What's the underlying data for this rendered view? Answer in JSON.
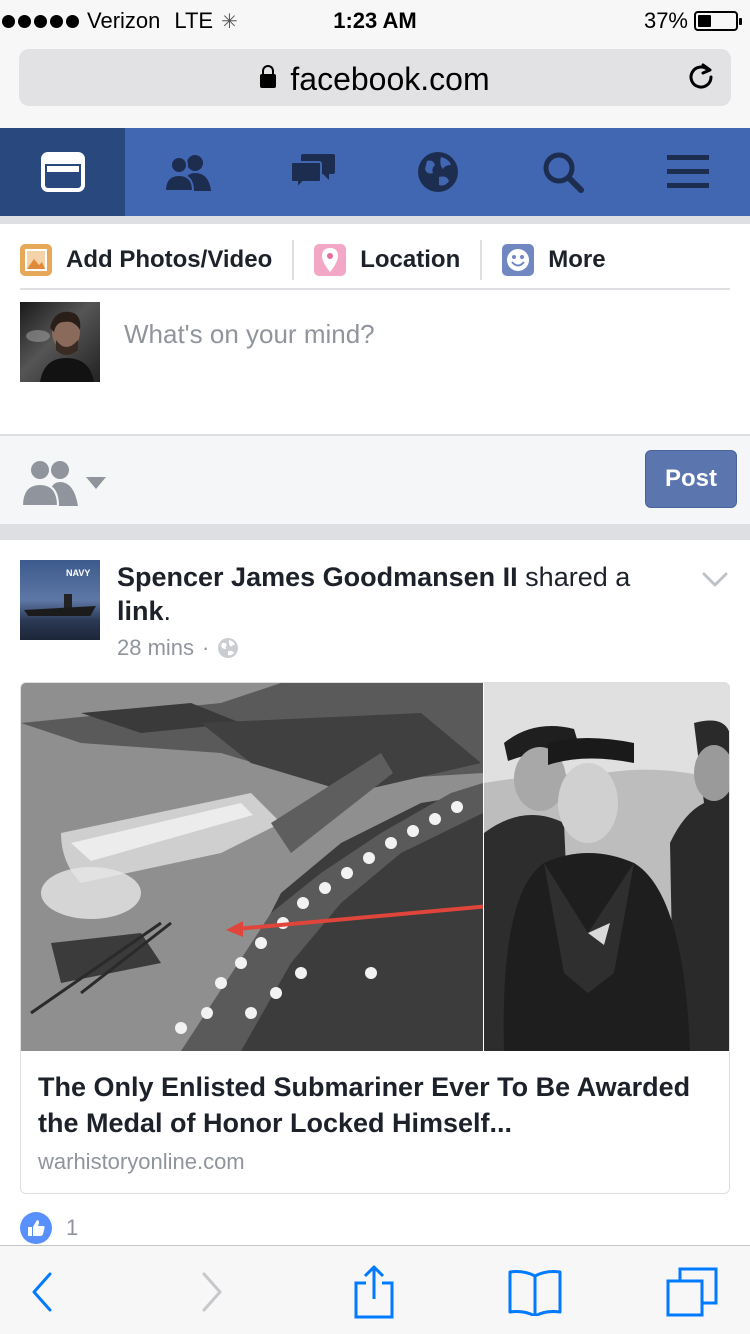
{
  "status_bar": {
    "carrier": "Verizon",
    "network": "LTE",
    "time": "1:23 AM",
    "battery": "37%",
    "battery_level": 0.37
  },
  "browser": {
    "url": "facebook.com"
  },
  "fb_nav": {
    "tabs": [
      "news-feed-icon",
      "friends-icon",
      "messages-icon",
      "notifications-globe-icon",
      "search-icon",
      "menu-icon"
    ],
    "active_index": 0
  },
  "composer": {
    "actions": [
      {
        "label": "Add Photos/Video",
        "icon": "photo-icon",
        "color": "#e8a85a"
      },
      {
        "label": "Location",
        "icon": "location-pin-icon",
        "color": "#e36fa0"
      },
      {
        "label": "More",
        "icon": "smiley-icon",
        "color": "#7187c2"
      }
    ],
    "placeholder": "What's on your mind?",
    "post_label": "Post"
  },
  "post": {
    "author": "Spencer James Goodmansen II",
    "shared_text": "shared a",
    "link_word": "link",
    "period": ".",
    "time": "28 mins",
    "separator": "·",
    "avatar_badge": "NAVY",
    "card": {
      "title": "The Only Enlisted Submariner Ever To Be Awarded the Medal of Honor Locked Himself...",
      "domain": "warhistoryonline.com"
    },
    "like_count": "1"
  },
  "colors": {
    "fb_blue": "#4267b2",
    "fb_blue_active": "#29487d",
    "post_button": "#5b75ae",
    "like_blue": "#5890ff",
    "ios_blue": "#007aff"
  }
}
